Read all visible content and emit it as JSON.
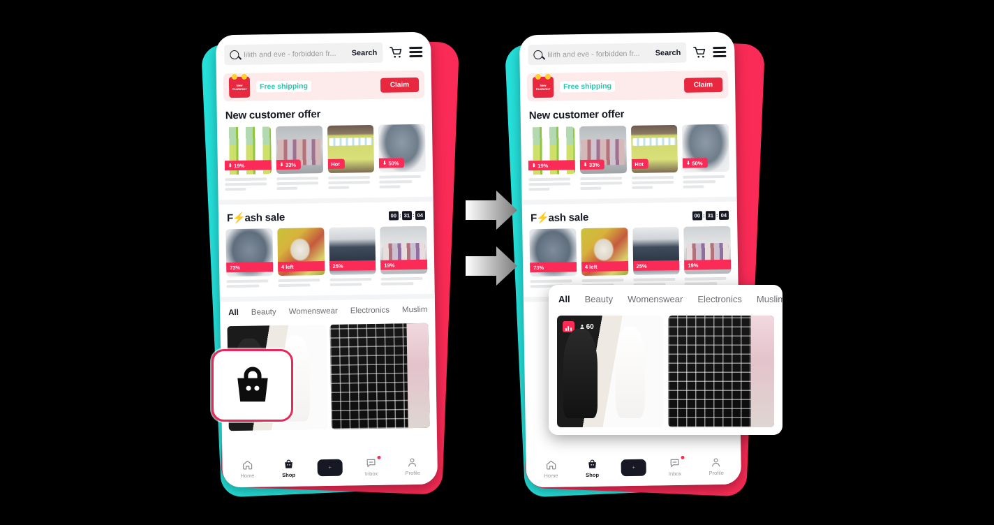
{
  "screen": {
    "background_color": "#000000",
    "frame_color": "#000000"
  },
  "colors": {
    "tiktok_red": "#FE2C55",
    "tiktok_cyan": "#25F4EE",
    "accent_crimson": "#E8283F",
    "callout_border": "#E8285A",
    "teal_text": "#2EC3B0",
    "ink": "#161823"
  },
  "arrows": [
    {
      "name": "transition-arrow-1",
      "direction": "right"
    },
    {
      "name": "transition-arrow-2",
      "direction": "right"
    }
  ],
  "callout": {
    "icon": "shopping-bag-icon",
    "label": "Shop"
  },
  "app": {
    "search": {
      "placeholder": "lilith and eve - forbidden fr...",
      "button_label": "Search",
      "icons": [
        "search-icon",
        "cart-icon",
        "menu-icon"
      ]
    },
    "promo": {
      "gift_label": "New Customer",
      "text": "Free shipping",
      "cta": "Claim"
    },
    "new_customer": {
      "title": "New customer offer",
      "products": [
        {
          "badge": "19%",
          "badge_type": "discount",
          "image": "spray-bottles"
        },
        {
          "badge": "33%",
          "badge_type": "discount",
          "image": "cleaning-bottles"
        },
        {
          "badge": "Hot",
          "badge_type": "hot",
          "image": "boxed-sprays"
        },
        {
          "badge": "50%",
          "badge_type": "discount",
          "image": "grey-hoodie"
        }
      ]
    },
    "flash_sale": {
      "title_prefix": "F",
      "title_suffix": "ash sale",
      "bolt": "⚡",
      "timer": {
        "hours": "00",
        "minutes": "31",
        "seconds": "04",
        "separator": ":"
      },
      "products": [
        {
          "badge": "73%",
          "badge_type": "discount",
          "image": "grey-hoodie"
        },
        {
          "badge": "4 left",
          "badge_type": "stock",
          "image": "printed-shirt"
        },
        {
          "badge": "25%",
          "badge_type": "discount",
          "image": "navy-sneakers"
        },
        {
          "badge": "19%",
          "badge_type": "discount",
          "image": "bottle-set"
        }
      ]
    },
    "category_tabs": [
      {
        "label": "All",
        "active": true
      },
      {
        "label": "Beauty",
        "active": false
      },
      {
        "label": "Womenswear",
        "active": false
      },
      {
        "label": "Electronics",
        "active": false
      },
      {
        "label": "Muslim",
        "active": false
      }
    ],
    "category_tabs_overlay": [
      {
        "label": "All",
        "active": true
      },
      {
        "label": "Beauty",
        "active": false
      },
      {
        "label": "Womenswear",
        "active": false
      },
      {
        "label": "Electronics",
        "active": false
      },
      {
        "label": "Muslim fa",
        "active": false
      }
    ],
    "feed": {
      "items": [
        {
          "image": "abaya-dresses",
          "live": true,
          "viewers": "60",
          "viewer_icon": "person-icon"
        },
        {
          "image": "black-checkered-bedding",
          "live": false,
          "viewers": ""
        }
      ]
    },
    "bottom_nav": [
      {
        "label": "Home",
        "icon": "home-icon",
        "active": false,
        "badge": false
      },
      {
        "label": "Shop",
        "icon": "shopping-bag-icon",
        "active": true,
        "badge": false
      },
      {
        "label": "",
        "icon": "plus-icon",
        "active": false,
        "badge": false
      },
      {
        "label": "Inbox",
        "icon": "inbox-icon",
        "active": false,
        "badge": true
      },
      {
        "label": "Profile",
        "icon": "person-icon",
        "active": false,
        "badge": false
      }
    ]
  }
}
